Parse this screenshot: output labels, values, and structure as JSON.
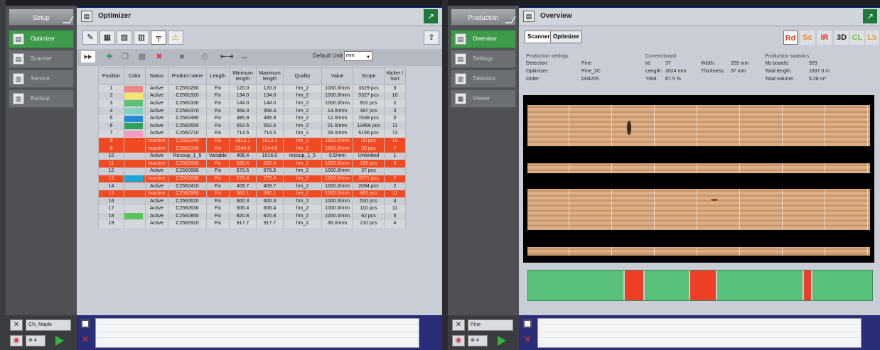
{
  "left": {
    "side_title": "Setup",
    "side_items": [
      {
        "label": "Optimizer",
        "active": true
      },
      {
        "label": "Scanner",
        "active": false
      },
      {
        "label": "Service",
        "active": false
      },
      {
        "label": "Backup",
        "active": false
      }
    ],
    "header_title": "Optimizer",
    "default_unit_label": "Default Unit",
    "default_unit_value": "mm",
    "bottom_field": "CN_Maple",
    "bottom_count": "4",
    "table": {
      "headers": [
        "Position",
        "Color",
        "Status",
        "Product name",
        "Length",
        "Minimum length",
        "Maximum length",
        "Quality",
        "Value",
        "Scope",
        "Kicker / Sort"
      ],
      "rows": [
        {
          "pos": "1",
          "color": "#f0857e",
          "status": "Active",
          "name": "C2560260",
          "length": "Fix",
          "min": "120.0",
          "max": "120.0",
          "quality": "hm_2",
          "value": "1000.0/mm",
          "scope": "3329 pcs",
          "kicker": "3"
        },
        {
          "pos": "2",
          "color": "#f6e46a",
          "status": "Active",
          "name": "C2560320",
          "length": "Fix",
          "min": "134.0",
          "max": "134.0",
          "quality": "hm_2",
          "value": "1000.0/mm",
          "scope": "5327 pcs",
          "kicker": "10"
        },
        {
          "pos": "3",
          "color": "#5bc074",
          "status": "Active",
          "name": "C2560330",
          "length": "Fix",
          "min": "144.0",
          "max": "144.0",
          "quality": "hm_2",
          "value": "1000.0/mm",
          "scope": "602 pcs",
          "kicker": "2"
        },
        {
          "pos": "4",
          "color": "#7fd1c4",
          "status": "Active",
          "name": "C2560370",
          "length": "Fix",
          "min": "358.3",
          "max": "358.3",
          "quality": "hm_2",
          "value": "14.0/mm",
          "scope": "387 pcs",
          "kicker": "3"
        },
        {
          "pos": "5",
          "color": "#1f8ad6",
          "status": "Active",
          "name": "C2560490",
          "length": "Fix",
          "min": "485.9",
          "max": "485.9",
          "quality": "hm_2",
          "value": "12.0/mm",
          "scope": "1538 pcs",
          "kicker": "5"
        },
        {
          "pos": "6",
          "color": "#2ea35a",
          "status": "Active",
          "name": "C2560550",
          "length": "Fix",
          "min": "552.5",
          "max": "552.5",
          "quality": "hm_2",
          "value": "21.0/mm",
          "scope": "13468 pcs",
          "kicker": "11"
        },
        {
          "pos": "7",
          "color": "#f59ac0",
          "status": "Active",
          "name": "C2560720",
          "length": "Fix",
          "min": "714.5",
          "max": "714.5",
          "quality": "hm_2",
          "value": "28.0/mm",
          "scope": "6156 pcs",
          "kicker": "73"
        },
        {
          "pos": "8",
          "color": "",
          "status": "Inactive",
          "name": "C2561940",
          "length": "Fix",
          "min": "1813.1",
          "max": "1813.1",
          "quality": "hm_2",
          "value": "1000.0/mm",
          "scope": "20 pcs",
          "kicker": "10"
        },
        {
          "pos": "9",
          "color": "",
          "status": "Inactive",
          "name": "C2561240",
          "length": "Fix",
          "min": "1244.6",
          "max": "1244.6",
          "quality": "hm_2",
          "value": "1000.0/mm",
          "scope": "20 pcs",
          "kicker": "7"
        },
        {
          "pos": "10",
          "color": "",
          "status": "Active",
          "name": "Recoup_1_5",
          "length": "Variable",
          "min": "406.4",
          "max": "1016.0",
          "quality": "recoup_1_5",
          "value": "0.5/mm",
          "scope": "Unlimited",
          "kicker": "1"
        },
        {
          "pos": "11",
          "color": "",
          "status": "Inactive",
          "name": "C2560530",
          "length": "Fix",
          "min": "530.4",
          "max": "530.4",
          "quality": "hm_2",
          "value": "1000.0/mm",
          "scope": "165 pcs",
          "kicker": "9"
        },
        {
          "pos": "12",
          "color": "",
          "status": "Active",
          "name": "C2560680",
          "length": "Fix",
          "min": "679.5",
          "max": "679.5",
          "quality": "hm_2",
          "value": "1000.0/mm",
          "scope": "37 pcs",
          "kicker": ""
        },
        {
          "pos": "13",
          "color": "#1aa6d9",
          "status": "Inactive",
          "name": "C2560280",
          "length": "Fix",
          "min": "279.4",
          "max": "279.4",
          "quality": "hm_2",
          "value": "1000.0/mm",
          "scope": "2071 pcs",
          "kicker": "7"
        },
        {
          "pos": "14",
          "color": "",
          "status": "Active",
          "name": "C2560410",
          "length": "Fix",
          "min": "409.7",
          "max": "409.7",
          "quality": "hm_2",
          "value": "1000.0/mm",
          "scope": "2094 pcs",
          "kicker": "2"
        },
        {
          "pos": "15",
          "color": "",
          "status": "Inactive",
          "name": "C2560960",
          "length": "Fix",
          "min": "960.1",
          "max": "960.1",
          "quality": "hm_2",
          "value": "1000.0/mm",
          "scope": "483 pcs",
          "kicker": "11"
        },
        {
          "pos": "16",
          "color": "",
          "status": "Active",
          "name": "C2560620",
          "length": "Fix",
          "min": "600.3",
          "max": "600.3",
          "quality": "hm_2",
          "value": "1000.0/mm",
          "scope": "510 pcs",
          "kicker": "4"
        },
        {
          "pos": "17",
          "color": "",
          "status": "Active",
          "name": "C2560630",
          "length": "Fix",
          "min": "606.4",
          "max": "606.4",
          "quality": "hm_2",
          "value": "1000.0/mm",
          "scope": "110 pcs",
          "kicker": "11"
        },
        {
          "pos": "18",
          "color": "#5ac35a",
          "status": "Active",
          "name": "C2560850",
          "length": "Fix",
          "min": "820.8",
          "max": "820.8",
          "quality": "hm_2",
          "value": "1000.0/mm",
          "scope": "62 pcs",
          "kicker": "5"
        },
        {
          "pos": "19",
          "color": "",
          "status": "Active",
          "name": "C2560920",
          "length": "Fix",
          "min": "917.7",
          "max": "917.7",
          "quality": "hm_2",
          "value": "36.0/mm",
          "scope": "210 pcs",
          "kicker": "4"
        }
      ]
    }
  },
  "right": {
    "side_title": "Production",
    "side_items": [
      {
        "label": "Overview",
        "active": true
      },
      {
        "label": "Settings",
        "active": false
      },
      {
        "label": "Statistics",
        "active": false
      },
      {
        "label": "Viewer",
        "active": false
      }
    ],
    "header_title": "Overview",
    "tabs": [
      "Scanner",
      "Optimizer"
    ],
    "modes": [
      {
        "label": "Rd",
        "color": "#e23a20"
      },
      {
        "label": "Sc",
        "color": "#e8892a"
      },
      {
        "label": "IR",
        "color": "#e23a20"
      },
      {
        "label": "3D",
        "color": "#222222"
      },
      {
        "label": "CL",
        "color": "#7ac142"
      },
      {
        "label": "Lb",
        "color": "#e8a23a"
      }
    ],
    "production_settings": {
      "title": "Production settings",
      "rows": [
        {
          "k": "Detection:",
          "v": "Pine"
        },
        {
          "k": "Optimizer:",
          "v": "Pine_2C"
        },
        {
          "k": "Order:",
          "v": "D04205"
        }
      ]
    },
    "current_board": {
      "title": "Current board",
      "rows": [
        {
          "k": "Id:",
          "v": "37",
          "k2": "Width:",
          "v2": "209 mm"
        },
        {
          "k": "Length:",
          "v": "2024 mm",
          "k2": "Thickness:",
          "v2": "37 mm"
        },
        {
          "k": "Yield:",
          "v": "87.5 %",
          "k2": "",
          "v2": ""
        }
      ]
    },
    "production_statistics": {
      "title": "Production statistics",
      "rows": [
        {
          "k": "Nb boards:",
          "v": "929"
        },
        {
          "k": "Total length:",
          "v": "1837.0 m"
        },
        {
          "k": "Total volume:",
          "v": "5.28 m³"
        }
      ]
    },
    "bottom_field": "Pine",
    "bottom_count": "4"
  }
}
